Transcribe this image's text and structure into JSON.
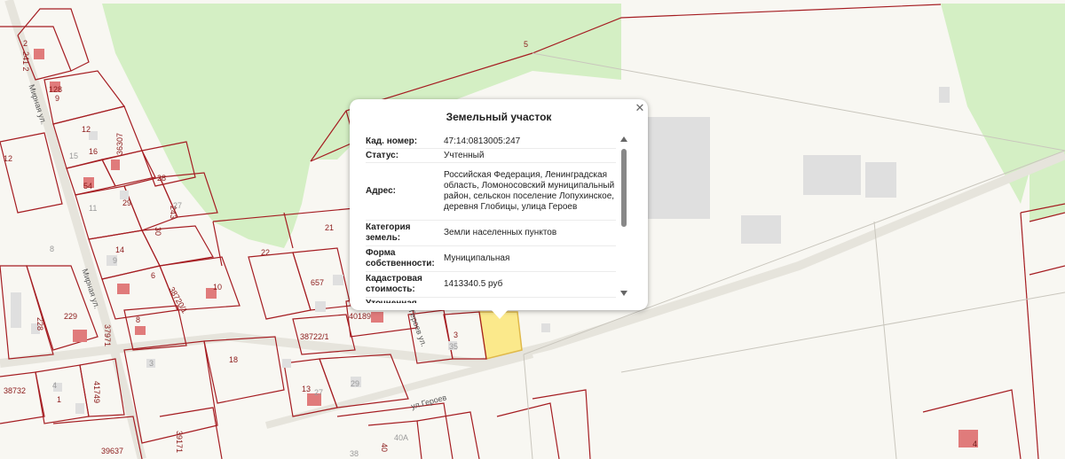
{
  "popup": {
    "title": "Земельный участок",
    "close_icon": "close-icon",
    "rows": [
      {
        "key": "Кад. номер:",
        "value": "47:14:0813005:247"
      },
      {
        "key": "Статус:",
        "value": "Учтенный"
      },
      {
        "key": "Адрес:",
        "value": "Российская Федерация, Ленинградская область, Ломоносовский муниципальный район, сельскон поселение Лопухинское, деревня Глобицы, улица Героев"
      },
      {
        "key": "Категория земель:",
        "value": "Земли населенных пунктов"
      },
      {
        "key": "Форма собственности:",
        "value": "Муниципальная"
      },
      {
        "key": "Кадастровая стоимость:",
        "value": "1413340.5 руб"
      },
      {
        "key": "Уточненная",
        "value": ""
      }
    ]
  },
  "map": {
    "colors": {
      "forest": "#d4efc4",
      "background": "#f8f7f2",
      "parcel_border": "#a51d22",
      "building": "#dfdfdf",
      "house": "#e07b7b",
      "selected_parcel": "#fbe98b"
    },
    "street_labels": [
      "Мирная ул.",
      "Мирная ул.",
      "ул.Героев",
      "Героев ул."
    ],
    "parcel_labels": [
      "5",
      "2",
      "241 2",
      "128",
      "9",
      "12",
      "16",
      "12",
      "15",
      "54",
      "36307",
      "28",
      "11",
      "29",
      "27",
      "243",
      "30",
      "14",
      "9",
      "6",
      "21",
      "22",
      "657",
      "40189",
      "38722/1",
      "38720/1",
      "10",
      "8",
      "229",
      "228",
      "37971",
      "3",
      "18",
      "13",
      "27",
      "29",
      "3",
      "35",
      "38732",
      "4",
      "1",
      "41749",
      "39637",
      "39171",
      "40A",
      "38",
      "40",
      "4",
      "8"
    ]
  }
}
